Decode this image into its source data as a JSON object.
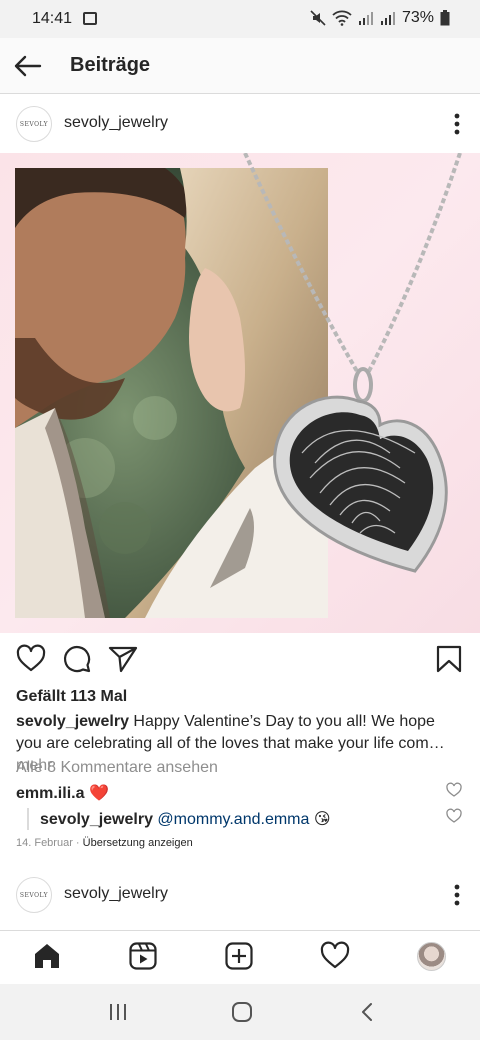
{
  "status_bar": {
    "time": "14:41",
    "battery": "73%",
    "icons": [
      "image-icon",
      "mute-icon",
      "wifi-icon",
      "signal-icon",
      "signal-icon",
      "battery-icon"
    ]
  },
  "top_bar": {
    "title": "Beiträge",
    "back_icon": "arrow-left-icon"
  },
  "post": {
    "username": "sevoly_jewelry",
    "avatar_text": "SEVOLY",
    "image_icon": "post-photo",
    "likes": "Gefällt 113 Mal",
    "caption_user": "sevoly_jewelry",
    "caption_text": "Happy Valentine’s Day to you all! We hope you are celebrating all of the loves that make your life com…",
    "caption_more": " mehr",
    "view_comments": "Alle 8 Kommentare ansehen",
    "comment": {
      "user": "emm.ili.a",
      "text": "❤️"
    },
    "reply": {
      "user": "sevoly_jewelry",
      "mention": "@mommy.and.emma",
      "emoji": "😘"
    },
    "date": "14. Februar",
    "separator": " · ",
    "translate": "Übersetzung anzeigen"
  },
  "next_post": {
    "username": "sevoly_jewelry",
    "avatar_text": "SEVOLY"
  },
  "bottom_nav": [
    "home-icon",
    "reels-icon",
    "new-post-icon",
    "activity-heart-icon",
    "profile-avatar"
  ],
  "system_nav": [
    "recents-icon",
    "home-circle-icon",
    "back-chevron-icon"
  ],
  "colors": {
    "text": "#262626",
    "secondary": "#8e8e8e",
    "mention": "#00376b",
    "heart_red": "#ed4956",
    "image_background": "#fbe3e8"
  }
}
